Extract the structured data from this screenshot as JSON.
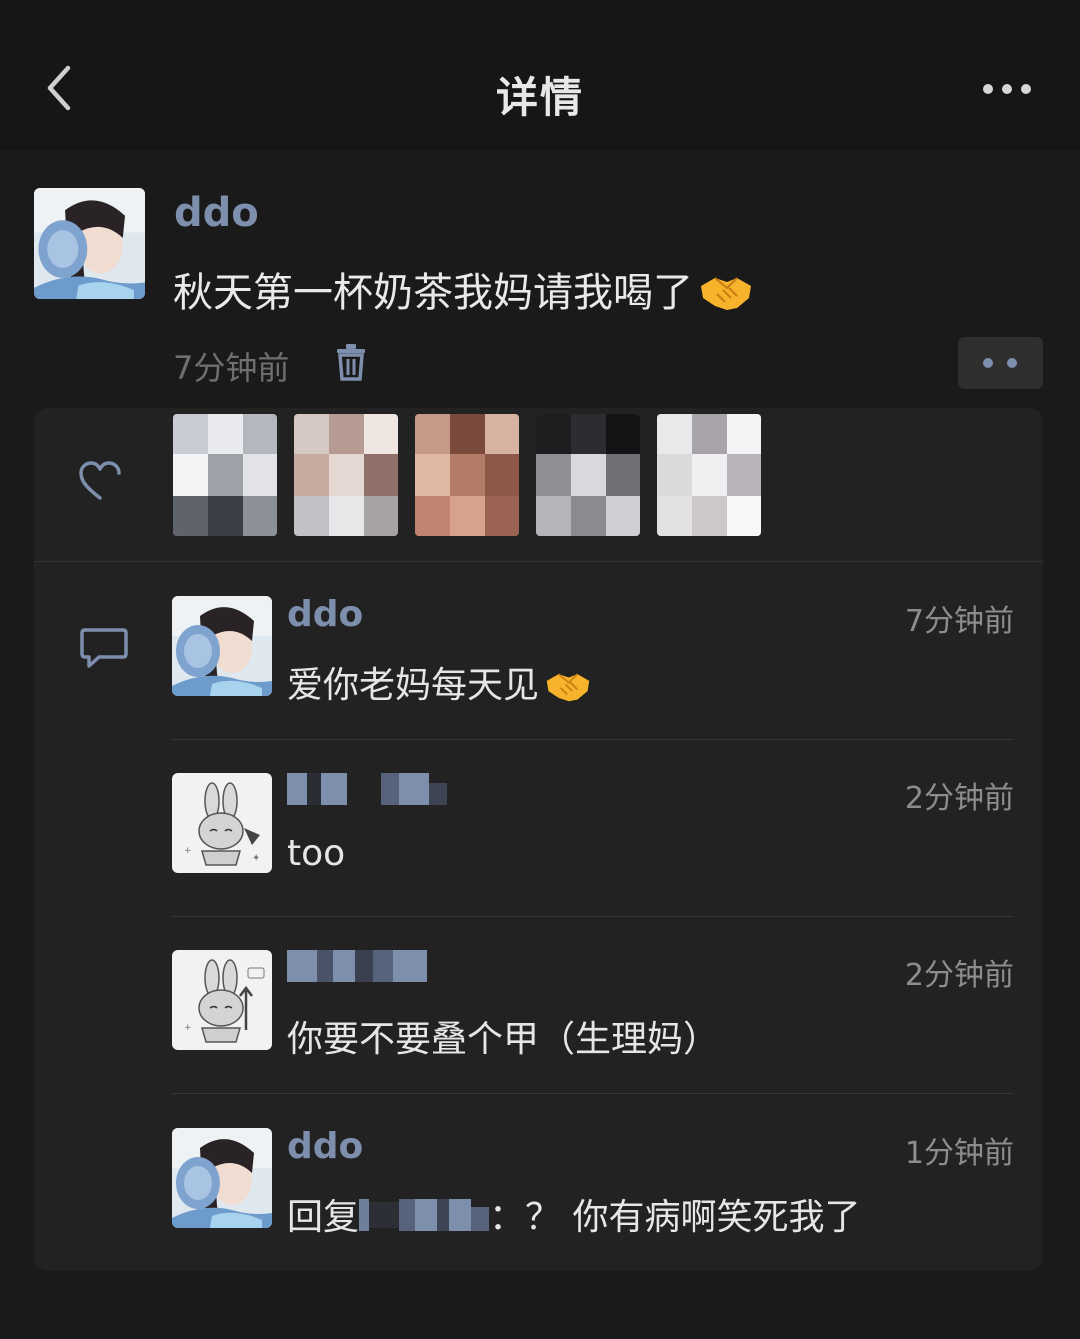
{
  "header": {
    "title": "详情"
  },
  "post": {
    "author": "ddo",
    "text": "秋天第一杯奶茶我妈请我喝了",
    "emoji": "handshake-emoji",
    "time": "7分钟前"
  },
  "likes": {
    "count_visible": 5
  },
  "comments": [
    {
      "author": "ddo",
      "time": "7分钟前",
      "text": "爱你老妈每天见",
      "emoji": "handshake-emoji"
    },
    {
      "author": "",
      "time": "2分钟前",
      "text": "too"
    },
    {
      "author": "",
      "time": "2分钟前",
      "text": "你要不要叠个甲（生理妈）"
    },
    {
      "author": "ddo",
      "time": "1分钟前",
      "reply_prefix": "回复",
      "text": "：？ 你有病啊笑死我了"
    }
  ],
  "colors": {
    "background": "#1a1a1a",
    "header": "#161616",
    "panel": "#222222",
    "name": "#7d8fad",
    "text": "#e6e6e6",
    "muted": "#8d8d8d"
  }
}
